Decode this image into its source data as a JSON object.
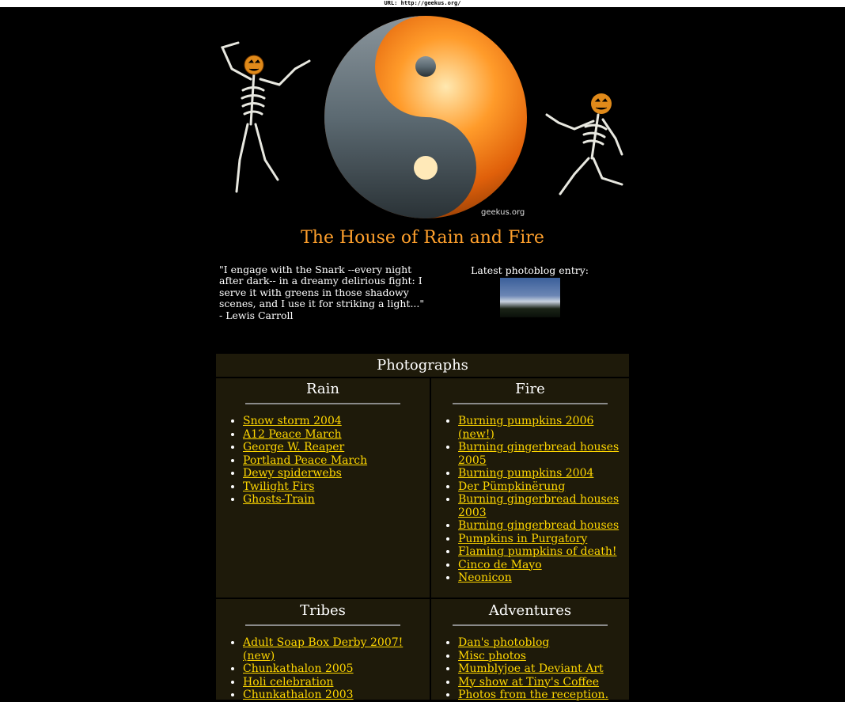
{
  "url_bar": "URL: http://geekus.org/",
  "banner": {
    "brand": "geekus.org"
  },
  "site_title": "The House of Rain and Fire",
  "quote": "\"I engage with the Snark --every night after dark-- in a dreamy delirious fight: I serve it with greens in those shadowy scenes, and I use it for striking a light...\" - Lewis Carroll",
  "latest": {
    "label": "Latest photoblog entry:"
  },
  "panel": {
    "title": "Photographs",
    "rain": {
      "title": "Rain",
      "items": [
        "Snow storm 2004",
        "A12 Peace March",
        "George W. Reaper",
        "Portland Peace March",
        "Dewy spiderwebs",
        "Twilight Firs",
        "Ghosts-Train"
      ]
    },
    "fire": {
      "title": "Fire",
      "items": [
        "Burning pumpkins 2006 (new!)",
        "Burning gingerbread houses 2005",
        "Burning pumpkins 2004",
        "Der Pümpkinërung",
        "Burning gingerbread houses 2003",
        "Burning gingerbread houses",
        "Pumpkins in Purgatory",
        "Flaming pumpkins of death!",
        "Cinco de Mayo",
        "Neonicon"
      ]
    },
    "tribes": {
      "title": "Tribes",
      "items": [
        "Adult Soap Box Derby 2007! (new)",
        "Chunkathalon 2005",
        "Holi celebration",
        "Chunkathalon 2003"
      ]
    },
    "adventures": {
      "title": "Adventures",
      "items": [
        "Dan's photoblog",
        "Misc photos",
        "Mumblyjoe at Deviant Art",
        "My show at Tiny's Coffee",
        "Photos from the reception."
      ]
    }
  }
}
